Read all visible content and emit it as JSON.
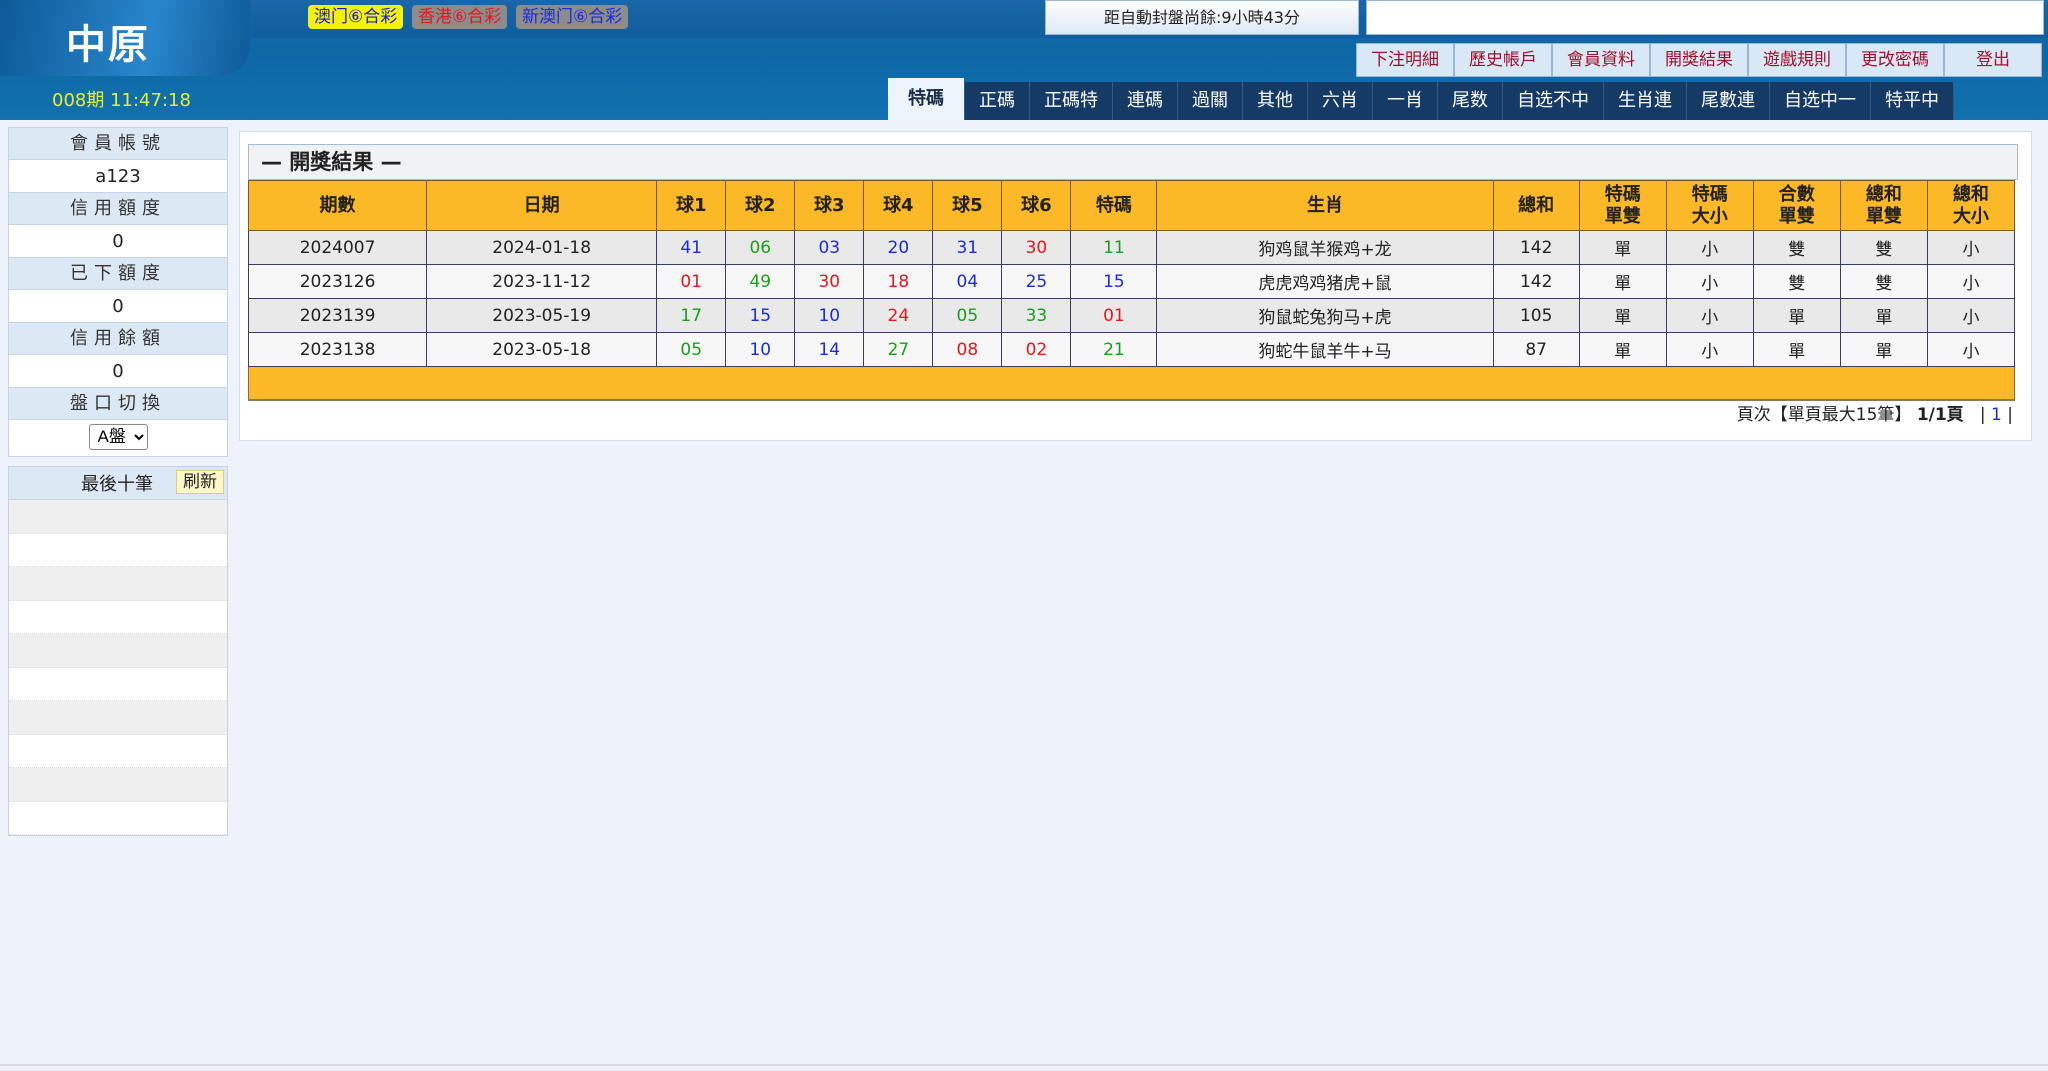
{
  "brand": "中原",
  "lotteries": [
    {
      "label": "澳门⑥合彩",
      "color": "#1a1ae0",
      "bg": "#f5f20a"
    },
    {
      "label": "香港⑥合彩",
      "color": "#e8141e",
      "bg": "#8c8c8c"
    },
    {
      "label": "新澳门⑥合彩",
      "color": "#1a2ae0",
      "bg": "#8c8c8c"
    }
  ],
  "countdown": "距自動封盤尚餘:9小時43分",
  "period": "008期 11:47:18",
  "top_links": [
    "下注明細",
    "歷史帳戶",
    "會員資料",
    "開獎結果",
    "遊戲規則",
    "更改密碼",
    "登出"
  ],
  "tabs": [
    "特碼",
    "正碼",
    "正碼特",
    "連碼",
    "過關",
    "其他",
    "六肖",
    "一肖",
    "尾数",
    "自选不中",
    "生肖連",
    "尾數連",
    "自选中一",
    "特平中"
  ],
  "active_tab": "特碼",
  "sidebar": {
    "account_label": "會員帳號",
    "account": "a123",
    "credit_label": "信用額度",
    "credit": "0",
    "used_label": "已下額度",
    "used": "0",
    "balance_label": "信用餘額",
    "balance": "0",
    "switch_label": "盤口切換",
    "switch_value": "A盤",
    "last_label": "最後十筆",
    "refresh": "刷新"
  },
  "main": {
    "title": "— 開獎結果 —",
    "columns": [
      "期數",
      "日期",
      "球1",
      "球2",
      "球3",
      "球4",
      "球5",
      "球6",
      "特碼",
      "生肖",
      "總和",
      "特碼\n單雙",
      "特碼\n大小",
      "合數\n單雙",
      "總和\n單雙",
      "總和\n大小"
    ],
    "rows": [
      {
        "period": "2024007",
        "date": "2024-01-18",
        "balls": [
          [
            "41",
            "blue"
          ],
          [
            "06",
            "green"
          ],
          [
            "03",
            "blue"
          ],
          [
            "20",
            "blue"
          ],
          [
            "31",
            "blue"
          ],
          [
            "30",
            "red"
          ],
          [
            "11",
            "green"
          ]
        ],
        "zodiac": "狗鸡鼠羊猴鸡+龙",
        "sum": "142",
        "sp_odd": "單",
        "sp_size": "小",
        "comb_odd": "雙",
        "sum_odd": "雙",
        "sum_size": "小"
      },
      {
        "period": "2023126",
        "date": "2023-11-12",
        "balls": [
          [
            "01",
            "red"
          ],
          [
            "49",
            "green"
          ],
          [
            "30",
            "red"
          ],
          [
            "18",
            "red"
          ],
          [
            "04",
            "blue"
          ],
          [
            "25",
            "blue"
          ],
          [
            "15",
            "blue"
          ]
        ],
        "zodiac": "虎虎鸡鸡猪虎+鼠",
        "sum": "142",
        "sp_odd": "單",
        "sp_size": "小",
        "comb_odd": "雙",
        "sum_odd": "雙",
        "sum_size": "小"
      },
      {
        "period": "2023139",
        "date": "2023-05-19",
        "balls": [
          [
            "17",
            "green"
          ],
          [
            "15",
            "blue"
          ],
          [
            "10",
            "blue"
          ],
          [
            "24",
            "red"
          ],
          [
            "05",
            "green"
          ],
          [
            "33",
            "green"
          ],
          [
            "01",
            "red"
          ]
        ],
        "zodiac": "狗鼠蛇兔狗马+虎",
        "sum": "105",
        "sp_odd": "單",
        "sp_size": "小",
        "comb_odd": "單",
        "sum_odd": "單",
        "sum_size": "小"
      },
      {
        "period": "2023138",
        "date": "2023-05-18",
        "balls": [
          [
            "05",
            "green"
          ],
          [
            "10",
            "blue"
          ],
          [
            "14",
            "blue"
          ],
          [
            "27",
            "green"
          ],
          [
            "08",
            "red"
          ],
          [
            "02",
            "red"
          ],
          [
            "21",
            "green"
          ]
        ],
        "zodiac": "狗蛇牛鼠羊牛+马",
        "sum": "87",
        "sp_odd": "單",
        "sp_size": "小",
        "comb_odd": "單",
        "sum_odd": "單",
        "sum_size": "小"
      }
    ],
    "pager": {
      "text": "頁次【單頁最大15筆】",
      "pages": "1/1頁",
      "current": "1"
    }
  }
}
